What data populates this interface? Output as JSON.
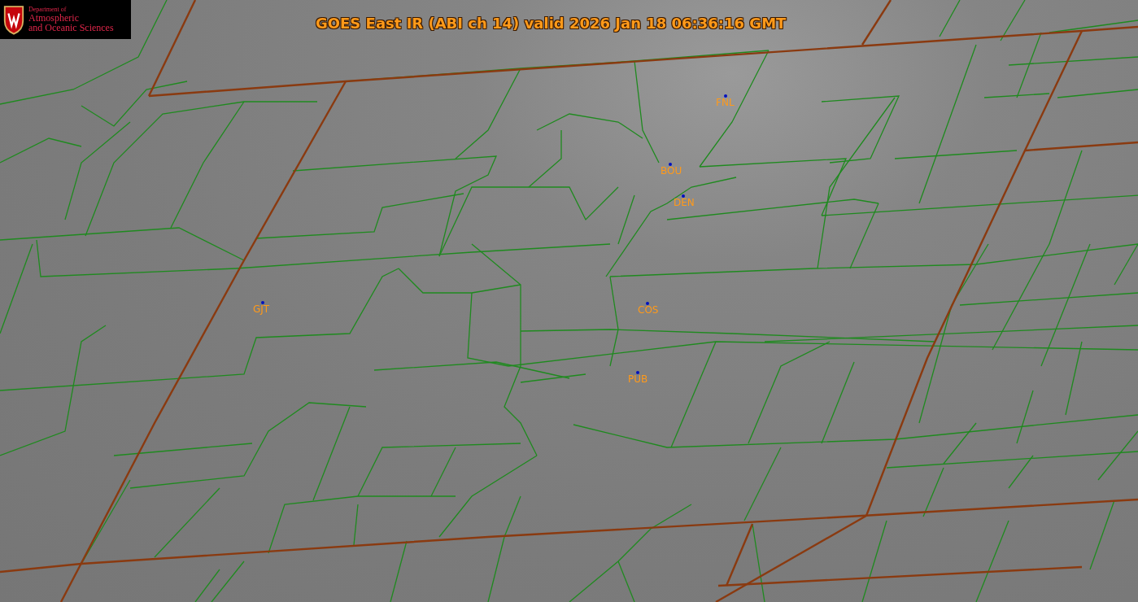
{
  "logo": {
    "small_line": "Department of",
    "line_1": "Atmospheric",
    "line_2": "and Oceanic Sciences"
  },
  "title": "GOES East IR (ABI ch 14) valid 2026 Jan 18 06:36:16 GMT",
  "stations": [
    {
      "label": "FNL"
    },
    {
      "label": "BOU"
    },
    {
      "label": "DEN"
    },
    {
      "label": "GJT"
    },
    {
      "label": "COS"
    },
    {
      "label": "PUB"
    }
  ]
}
